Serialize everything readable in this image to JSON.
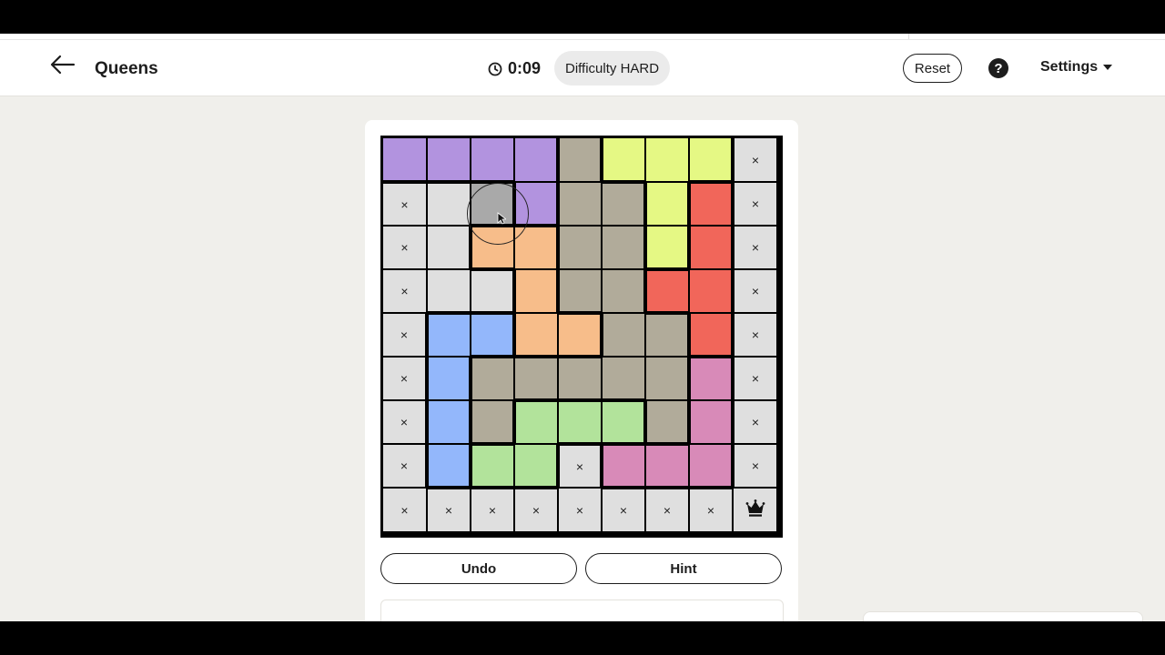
{
  "header": {
    "title": "Queens",
    "timer": "0:09",
    "difficulty": "Difficulty HARD",
    "reset_label": "Reset",
    "help_label": "?",
    "settings_label": "Settings"
  },
  "controls": {
    "undo_label": "Undo",
    "hint_label": "Hint"
  },
  "board": {
    "size": 9,
    "colors": {
      "purple": "#b293df",
      "yellow": "#e5f884",
      "olive": "#b1ab9a",
      "red": "#f1665a",
      "orange": "#f7bd8a",
      "blue": "#93b7fb",
      "pink": "#d88ab8",
      "green": "#b2e39b",
      "gray": "#dfdfdf",
      "pressed": "#a9a9a9"
    },
    "regions": [
      [
        "purple",
        "purple",
        "purple",
        "purple",
        "olive",
        "yellow",
        "yellow",
        "yellow",
        "gray"
      ],
      [
        "gray",
        "gray",
        "gray",
        "purple",
        "olive",
        "olive",
        "yellow",
        "red",
        "gray"
      ],
      [
        "gray",
        "gray",
        "orange",
        "orange",
        "olive",
        "olive",
        "yellow",
        "red",
        "gray"
      ],
      [
        "gray",
        "gray",
        "gray",
        "orange",
        "olive",
        "olive",
        "red",
        "red",
        "gray"
      ],
      [
        "gray",
        "blue",
        "blue",
        "orange",
        "orange",
        "olive",
        "olive",
        "red",
        "gray"
      ],
      [
        "gray",
        "blue",
        "olive",
        "olive",
        "olive",
        "olive",
        "olive",
        "pink",
        "gray"
      ],
      [
        "gray",
        "blue",
        "olive",
        "green",
        "green",
        "green",
        "olive",
        "pink",
        "gray"
      ],
      [
        "gray",
        "blue",
        "green",
        "green",
        "gray",
        "pink",
        "pink",
        "pink",
        "gray"
      ],
      [
        "gray",
        "gray",
        "gray",
        "gray",
        "gray",
        "gray",
        "gray",
        "gray",
        "gray"
      ]
    ],
    "marks": [
      [
        "",
        "",
        "",
        "",
        "",
        "",
        "",
        "",
        "x"
      ],
      [
        "x",
        "",
        "",
        "",
        "",
        "",
        "",
        "",
        "x"
      ],
      [
        "x",
        "",
        "",
        "",
        "",
        "",
        "",
        "",
        "x"
      ],
      [
        "x",
        "",
        "",
        "",
        "",
        "",
        "",
        "",
        "x"
      ],
      [
        "x",
        "",
        "",
        "",
        "",
        "",
        "",
        "",
        "x"
      ],
      [
        "x",
        "",
        "",
        "",
        "",
        "",
        "",
        "",
        "x"
      ],
      [
        "x",
        "",
        "",
        "",
        "",
        "",
        "",
        "",
        "x"
      ],
      [
        "x",
        "",
        "",
        "",
        "x",
        "",
        "",
        "",
        "x"
      ],
      [
        "x",
        "x",
        "x",
        "x",
        "x",
        "x",
        "x",
        "x",
        "Q"
      ]
    ],
    "pressed_cell": [
      1,
      2
    ],
    "x_glyph": "×",
    "queen_icon": "crown-icon"
  }
}
